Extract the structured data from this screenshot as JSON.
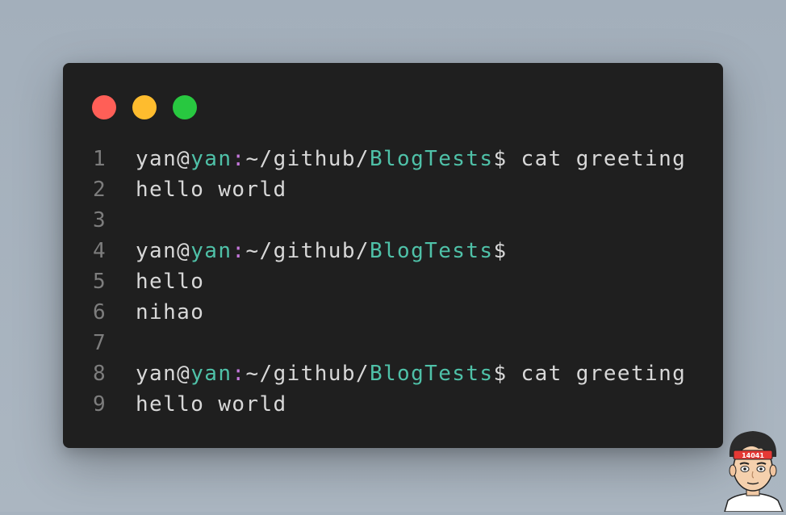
{
  "colors": {
    "background": "#a7b3bf",
    "window": "#1f1f1f",
    "close": "#ff5f57",
    "minimize": "#febc2e",
    "maximize": "#28c840",
    "host": "#4fc1a8",
    "dir": "#4fc1a8",
    "colon": "#c678dd",
    "text": "#d8d8d8",
    "line_number": "#7d7d7d"
  },
  "window_controls": [
    "close",
    "minimize",
    "maximize"
  ],
  "lines": [
    {
      "number": "1",
      "type": "prompt",
      "user": "yan",
      "at": "@",
      "host": "yan",
      "colon": ":",
      "path_prefix": "~/github/",
      "dir": "BlogTests",
      "suffix": "$ cat greeting"
    },
    {
      "number": "2",
      "type": "text",
      "text": "hello world"
    },
    {
      "number": "3",
      "type": "text",
      "text": ""
    },
    {
      "number": "4",
      "type": "prompt",
      "user": "yan",
      "at": "@",
      "host": "yan",
      "colon": ":",
      "path_prefix": "~/github/",
      "dir": "BlogTests",
      "suffix": "$"
    },
    {
      "number": "5",
      "type": "text",
      "text": "hello"
    },
    {
      "number": "6",
      "type": "text",
      "text": "nihao"
    },
    {
      "number": "7",
      "type": "text",
      "text": ""
    },
    {
      "number": "8",
      "type": "prompt",
      "user": "yan",
      "at": "@",
      "host": "yan",
      "colon": ":",
      "path_prefix": "~/github/",
      "dir": "BlogTests",
      "suffix": "$ cat greeting"
    },
    {
      "number": "9",
      "type": "text",
      "text": "hello world"
    }
  ],
  "avatar": {
    "icon": "cartoon-avatar-icon",
    "headband_text": "14041"
  }
}
